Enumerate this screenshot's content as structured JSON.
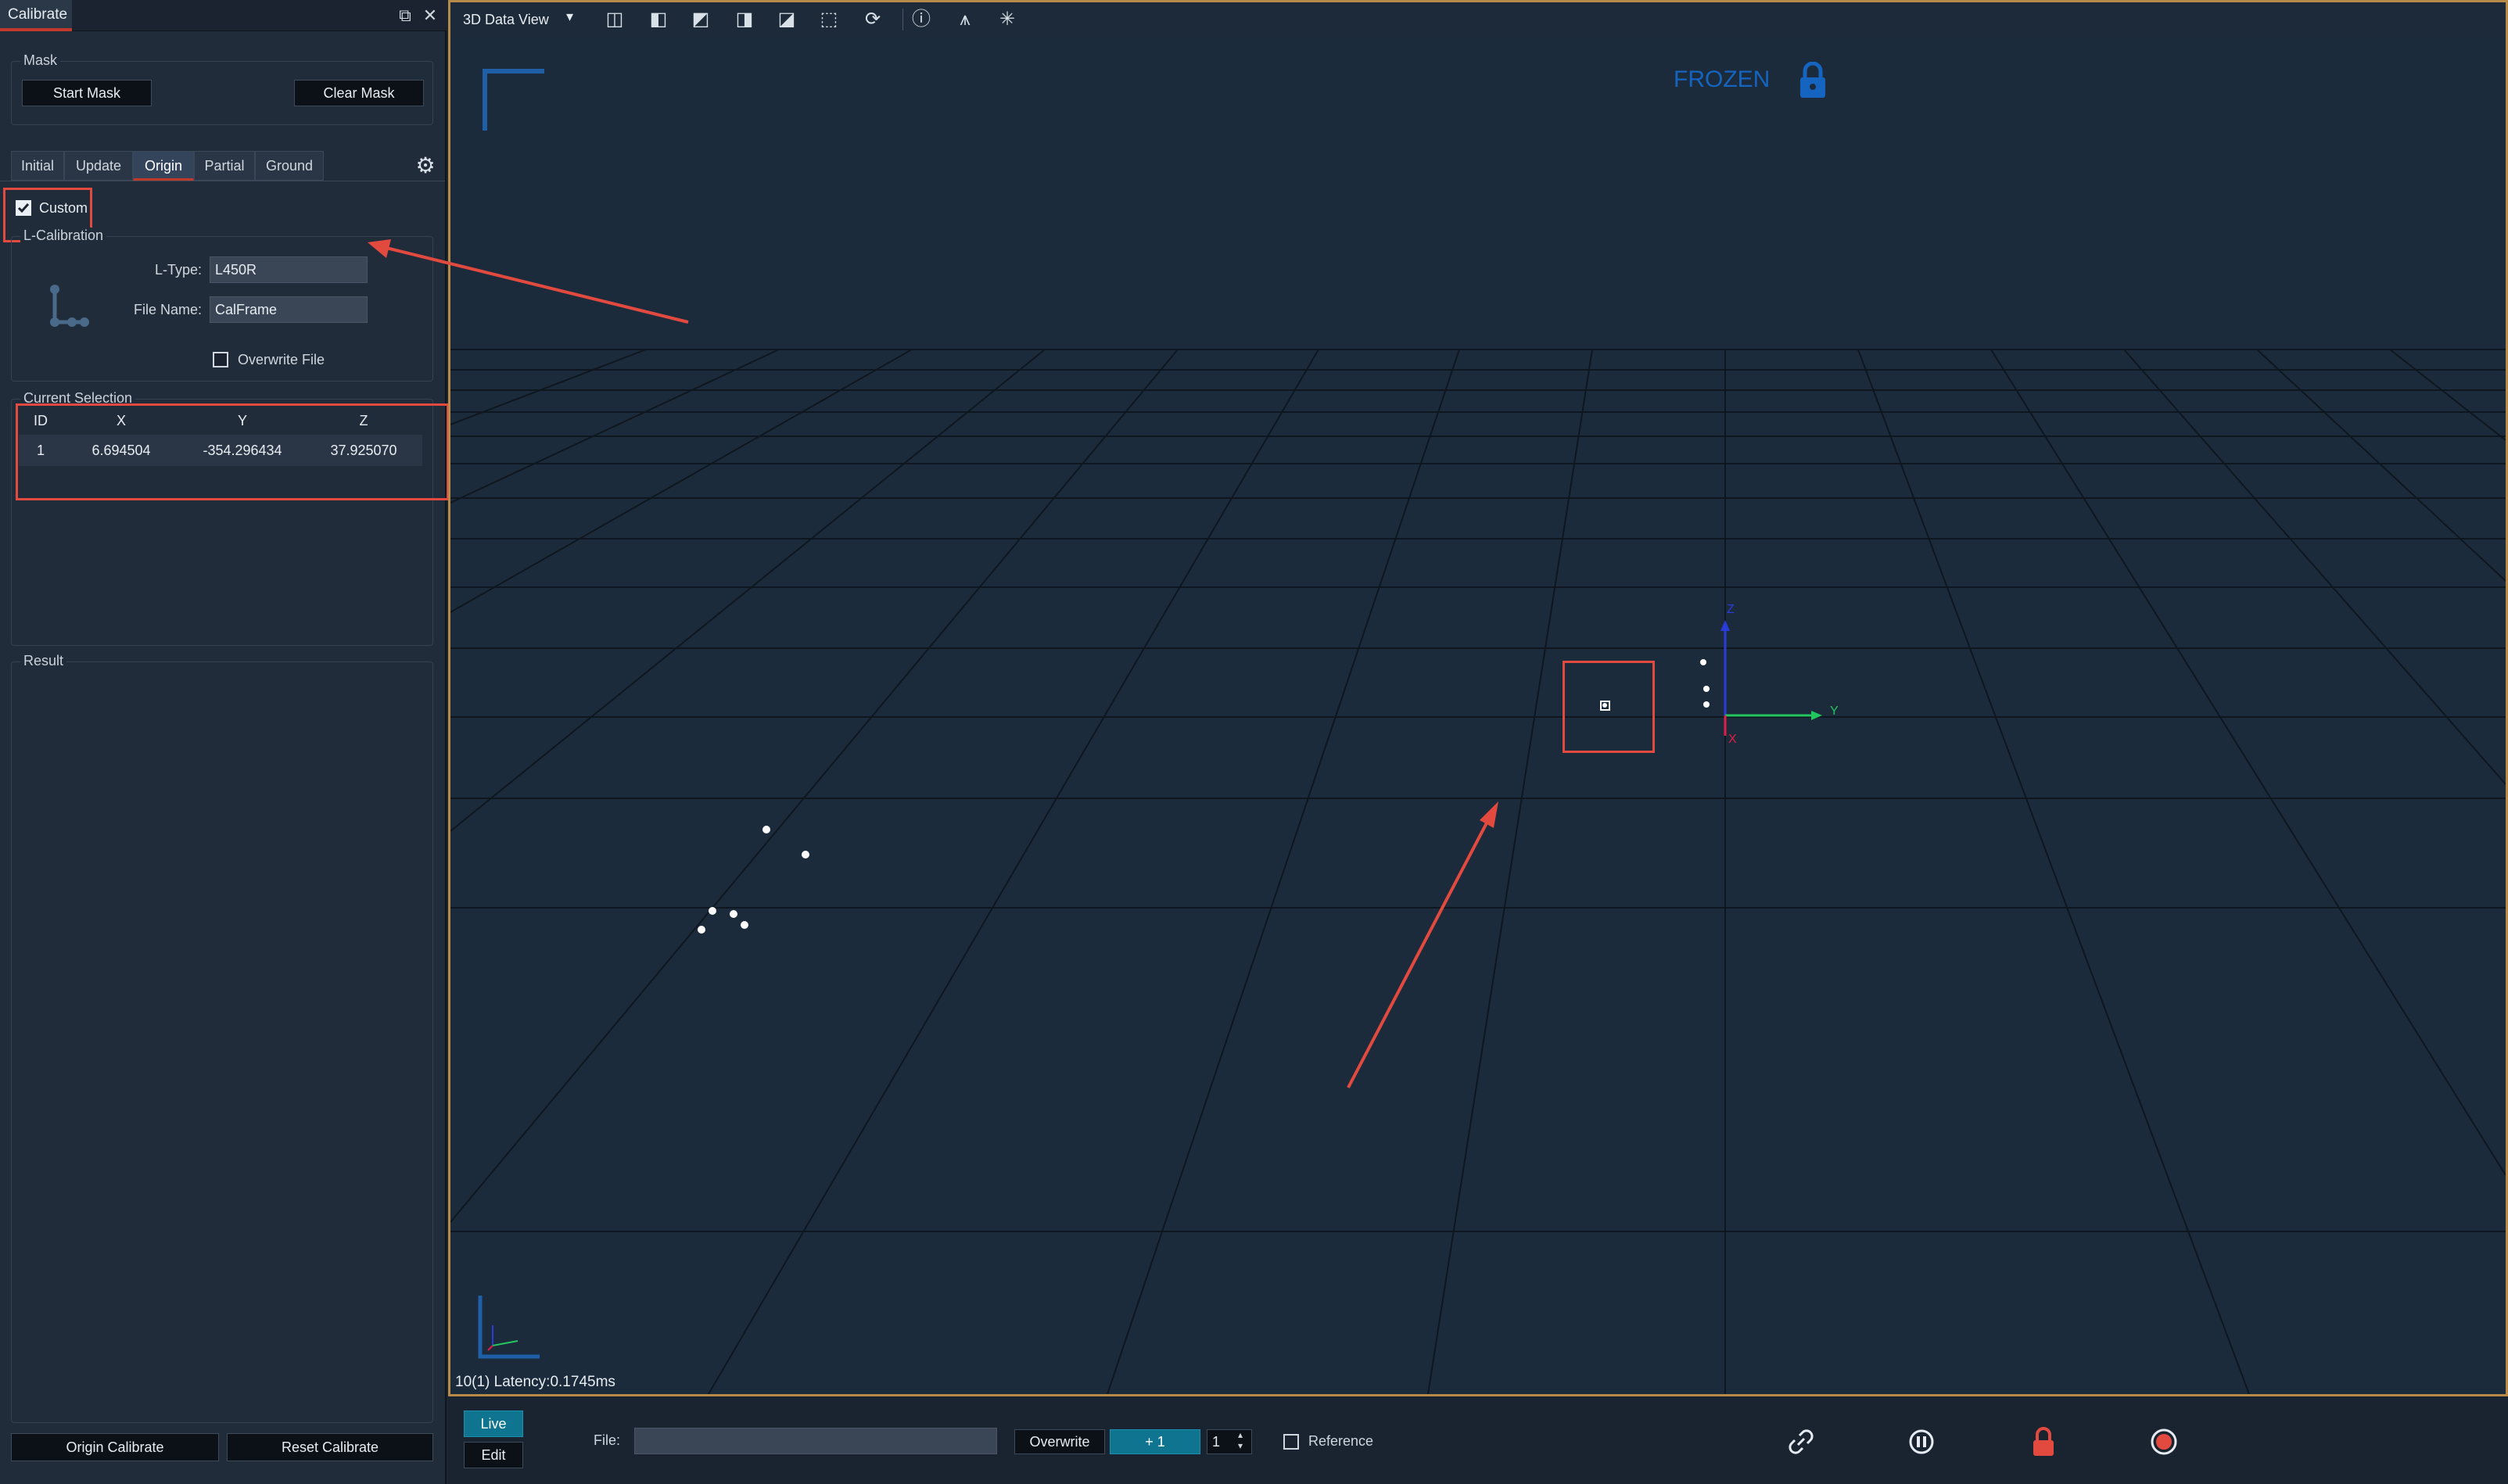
{
  "panel": {
    "title": "Calibrate",
    "mask": {
      "label": "Mask",
      "start_label": "Start Mask",
      "clear_label": "Clear Mask"
    },
    "tabs": [
      "Initial",
      "Update",
      "Origin",
      "Partial",
      "Ground"
    ],
    "active_tab": "Origin",
    "custom_label": "Custom",
    "custom_checked": true,
    "lcal": {
      "label": "L-Calibration",
      "ltype_label": "L-Type:",
      "ltype_value": "L450R",
      "filename_label": "File Name:",
      "filename_value": "CalFrame",
      "overwrite_label": "Overwrite File",
      "overwrite_checked": false
    },
    "selection": {
      "label": "Current Selection",
      "columns": [
        "ID",
        "X",
        "Y",
        "Z"
      ],
      "rows": [
        [
          "1",
          "6.694504",
          "-354.296434",
          "37.925070"
        ]
      ]
    },
    "result_label": "Result",
    "origin_calibrate_label": "Origin Calibrate",
    "reset_calibrate_label": "Reset Calibrate"
  },
  "viewport": {
    "view_name": "3D Data View",
    "frozen_label": "FROZEN",
    "latency_text": "10(1) Latency:0.1745ms",
    "axis_labels": {
      "y": "Y",
      "x": "X",
      "z": "Z"
    },
    "icons": [
      "cube-front-icon",
      "cube-left-icon",
      "cube-top-icon",
      "cube-right-icon",
      "cube-back-icon",
      "cube-iso-icon",
      "refresh-icon",
      "info-icon",
      "tripod-icon",
      "sparkle-icon"
    ]
  },
  "bottom": {
    "live_label": "Live",
    "edit_label": "Edit",
    "file_label": "File:",
    "file_value": "",
    "overwrite_label": "Overwrite",
    "plus_label": "+ 1",
    "spin_value": "1",
    "reference_label": "Reference",
    "reference_checked": false
  },
  "colors": {
    "accent_red": "#e34a3f",
    "frozen_blue": "#1565c0",
    "live_teal": "#0e7490"
  }
}
